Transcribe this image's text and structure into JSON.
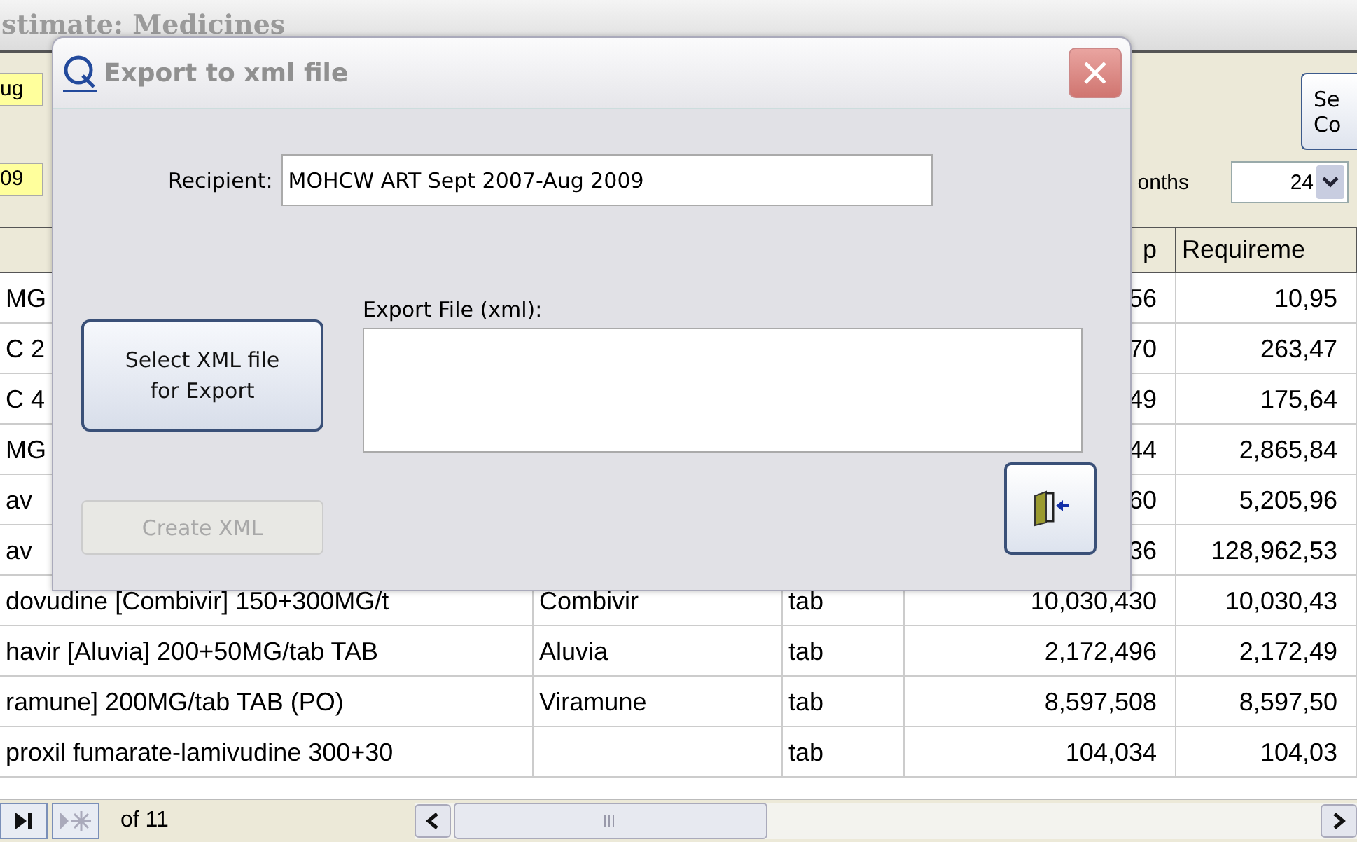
{
  "window": {
    "title": "stimate: Medicines"
  },
  "toolbar": {
    "date_from": "ug",
    "date_to": "09",
    "months_label": "onths",
    "months_value": "24",
    "side_button": [
      "Se",
      "Co"
    ]
  },
  "table": {
    "column_4": "p",
    "column_5": "Requireme",
    "rows": [
      {
        "column_1": "MG",
        "column_4": "56",
        "column_5": "10,95"
      },
      {
        "column_1": "C 2",
        "column_4": "70",
        "column_5": "263,47"
      },
      {
        "column_1": "C 4",
        "column_4": "49",
        "column_5": "175,64"
      },
      {
        "column_1": "MG",
        "column_4": "44",
        "column_5": "2,865,84"
      },
      {
        "column_1": "av",
        "column_4": "60",
        "column_5": "5,205,96"
      },
      {
        "column_1": "av",
        "column_4": "36",
        "column_5": "128,962,53"
      },
      {
        "column_1": "dovudine [Combivir]  150+300MG/t",
        "column_2": "Combivir",
        "column_3": "tab",
        "column_4": "10,030,430",
        "column_5": "10,030,43"
      },
      {
        "column_1": "havir [Aluvia]  200+50MG/tab TAB",
        "column_2": "Aluvia",
        "column_3": "tab",
        "column_4": "2,172,496",
        "column_5": "2,172,49"
      },
      {
        "column_1": "ramune]  200MG/tab TAB (PO)",
        "column_2": "Viramune",
        "column_3": "tab",
        "column_4": "8,597,508",
        "column_5": "8,597,50"
      },
      {
        "column_1": "proxil fumarate-lamivudine 300+30",
        "column_3": "tab",
        "column_4": "104,034",
        "column_5": "104,03"
      }
    ]
  },
  "navigator": {
    "record_count": "of 11"
  },
  "dialog": {
    "title": "Export to xml file",
    "recipient_label": "Recipient:",
    "recipient_value": "MOHCW ART Sept 2007-Aug 2009",
    "export_file_label": "Export File (xml):",
    "select_button": [
      "Select XML file",
      "for Export"
    ],
    "create_button": {
      "label": "Create XML",
      "disabled": true
    }
  }
}
